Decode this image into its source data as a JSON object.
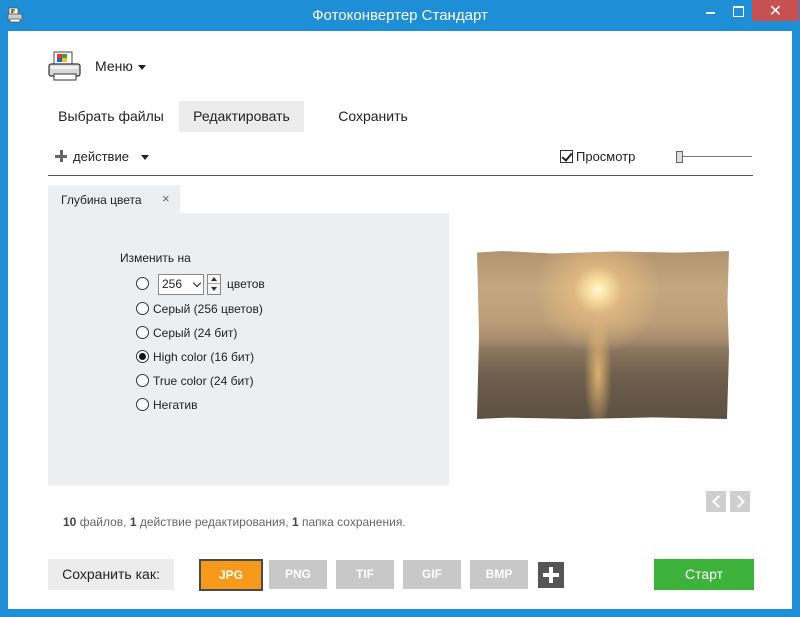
{
  "window": {
    "title": "Фотоконвертер Стандарт",
    "close_glyph": "✕",
    "icons": [
      "printer-app-icon",
      "minimize-icon",
      "maximize-icon",
      "close-icon"
    ]
  },
  "header": {
    "logo_icon": "printer-logo-icon",
    "menu_label": "Меню"
  },
  "tabs": [
    {
      "label": "Выбрать файлы",
      "active": false
    },
    {
      "label": "Редактировать",
      "active": true
    },
    {
      "label": "Сохранить",
      "active": false
    }
  ],
  "toolbar": {
    "action_label": "действие",
    "preview_label": "Просмотр",
    "preview_checked": true
  },
  "panel": {
    "tab_label": "Глубина цвета",
    "tab_close_glyph": "×",
    "change_to_label": "Изменить на",
    "color_count_value": "256",
    "color_count_suffix": "цветов",
    "options": [
      {
        "label": "",
        "selected": false
      },
      {
        "label": "Серый (256 цветов)",
        "selected": false
      },
      {
        "label": "Серый (24 бит)",
        "selected": false
      },
      {
        "label": "High color (16 бит)",
        "selected": true
      },
      {
        "label": "True color (24 бит)",
        "selected": false
      },
      {
        "label": "Негатив",
        "selected": false
      }
    ]
  },
  "preview": {
    "image": "sunset-over-sea-photo"
  },
  "status": {
    "files_count": "10",
    "files_label": "файлов,",
    "actions_count": "1",
    "actions_label": "действие редактирования,",
    "folders_count": "1",
    "folders_label": "папка сохранения."
  },
  "footer": {
    "save_as_label": "Сохранить как:",
    "formats": [
      "JPG",
      "PNG",
      "TIF",
      "GIF",
      "BMP"
    ],
    "selected_format": "JPG",
    "start_label": "Старт"
  },
  "colors": {
    "titlebar": "#1e8fd6",
    "close_button": "#c75050",
    "selected_format": "#f79a1b",
    "inactive_format": "#c8c8c8",
    "start_button": "#3db33b",
    "panel_bg": "#eceef0"
  }
}
